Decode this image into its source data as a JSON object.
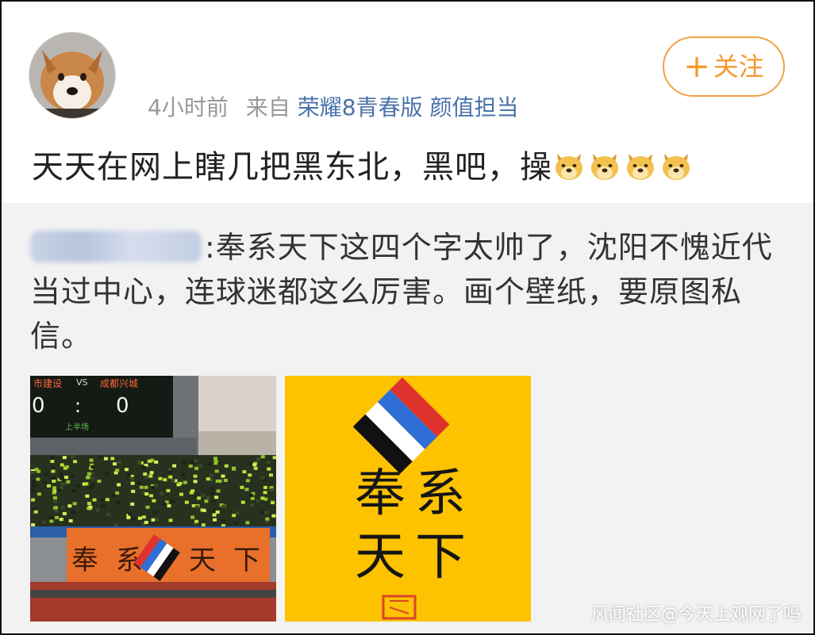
{
  "post": {
    "time": "4小时前",
    "from_label": "来自",
    "device": "荣耀8青春版 颜值担当",
    "follow_label": "关注",
    "text": "天天在网上瞎几把黑东北，黑吧，操",
    "emojis": [
      "doge-emoji",
      "doge-emoji",
      "doge-emoji",
      "doge-emoji"
    ]
  },
  "repost": {
    "text": ":奉系天下这四个字太帅了，沈阳不愧近代当过中心，连球迷都这么厉害。画个壁纸，要原图私信。"
  },
  "images": {
    "stadium": {
      "scoreboard_left": "市建设",
      "scoreboard_vs": "VS",
      "scoreboard_right": "成都兴城",
      "score_left": "0",
      "score_sep": ":",
      "score_right": "0",
      "scoreboard_sub": "上半场",
      "banner_text": [
        "奉",
        "系",
        "天",
        "下"
      ]
    },
    "wallpaper": {
      "chars": [
        "奉",
        "系",
        "天",
        "下"
      ]
    }
  },
  "watermark": "风闻社区@今天上观网了吗",
  "colors": {
    "follow_orange": "#f29a2e",
    "link_blue": "#4a72a8",
    "wallpaper_yellow": "#fdc200",
    "flag_red": "#e0322d",
    "flag_blue": "#2f6fd6"
  }
}
